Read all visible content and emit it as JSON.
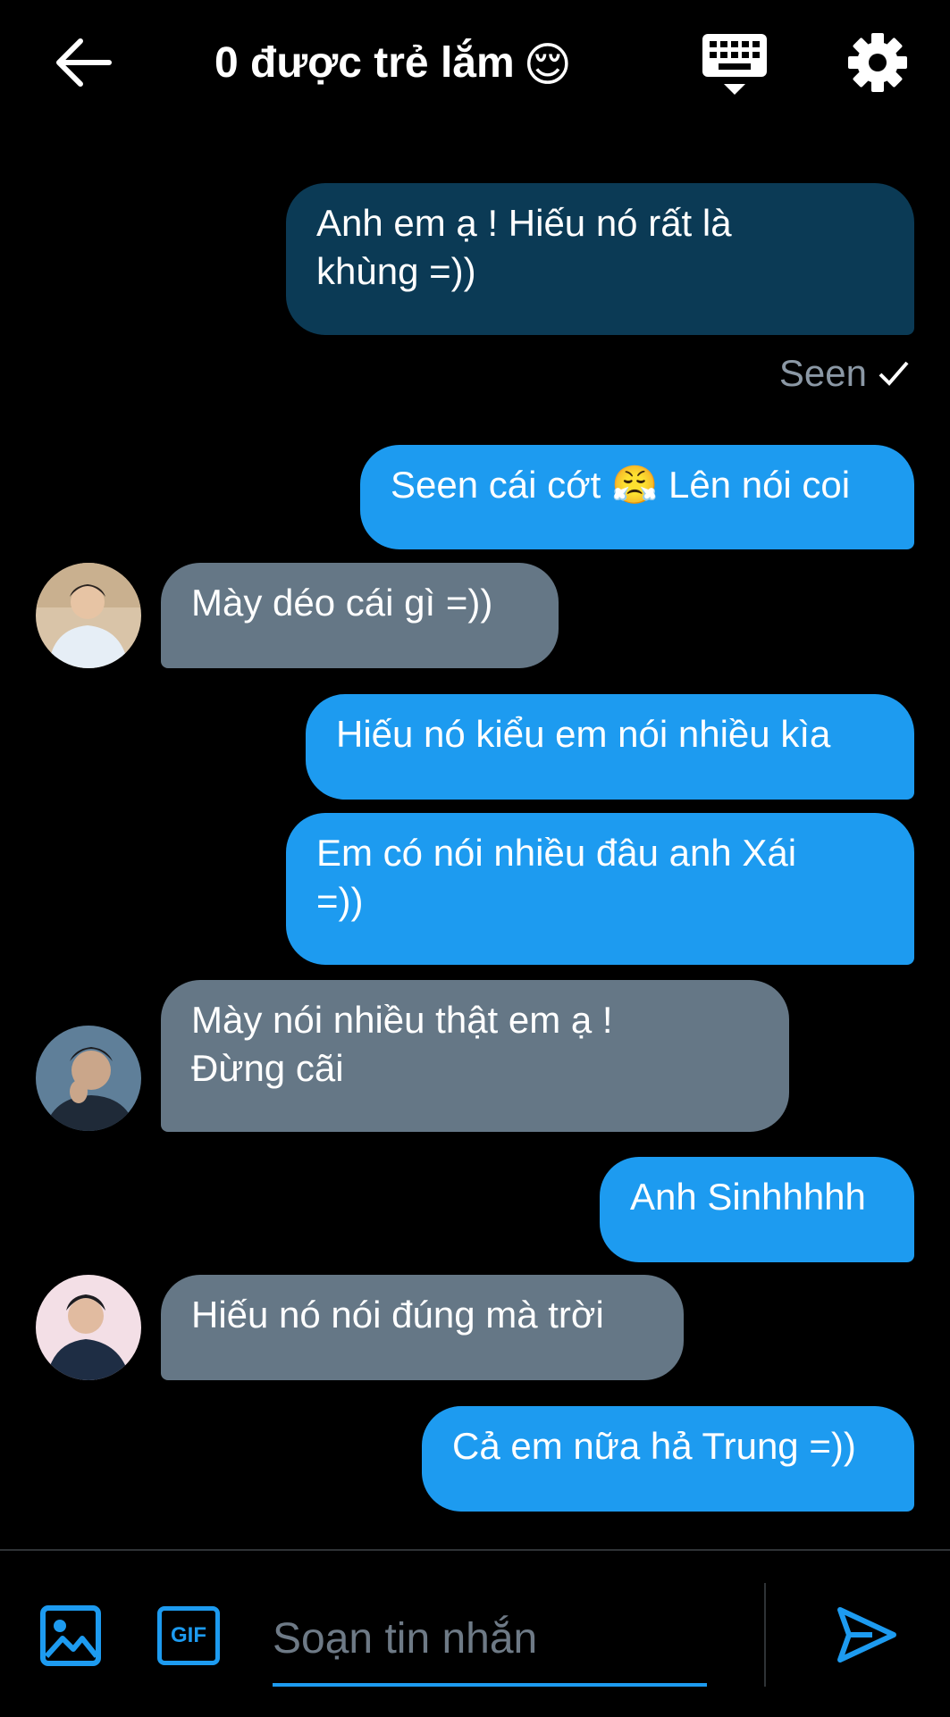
{
  "header": {
    "title": "0 được trẻ lắm",
    "title_emoji": "😌",
    "back_icon": "arrow-left-icon",
    "keyboard_icon": "keyboard-icon",
    "settings_icon": "gear-icon"
  },
  "messages": [
    {
      "side": "out",
      "text": "Anh em ạ ! Hiếu nó rất là\nkhùng =))",
      "status": "sent-dark"
    },
    {
      "side": "out",
      "text": "Seen cái cớt 😤 Lên nói coi"
    },
    {
      "side": "in",
      "text": "Mày déo cái gì =))"
    },
    {
      "side": "out",
      "text": "Hiếu nó kiểu em nói nhiều kìa"
    },
    {
      "side": "out",
      "text": "Em có nói nhiều đâu anh Xái\n=))"
    },
    {
      "side": "in",
      "text": "Mày nói nhiều thật em ạ !\nĐừng cãi"
    },
    {
      "side": "out",
      "text": "Anh Sinhhhhh"
    },
    {
      "side": "in",
      "text": "Hiếu nó nói đúng mà trời"
    },
    {
      "side": "out",
      "text": "Cả em nữa hả Trung =))"
    }
  ],
  "seen_label": "Seen",
  "composer": {
    "placeholder": "Soạn tin nhắn",
    "gif_label": "GIF",
    "image_icon": "image-icon",
    "send_icon": "send-icon"
  },
  "colors": {
    "accent": "#1d9bf0",
    "incoming_bubble": "#657786",
    "first_bubble": "#0b3a55",
    "background": "#000000"
  }
}
